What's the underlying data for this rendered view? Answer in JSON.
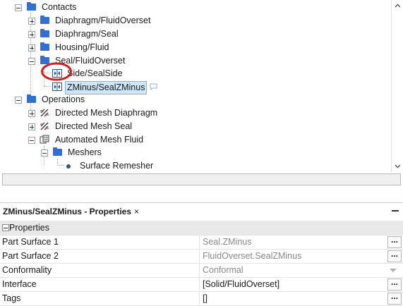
{
  "tree": {
    "contacts": "Contacts",
    "diaphragm_fluidoverset": "Diaphragm/FluidOverset",
    "diaphragm_seal": "Diaphragm/Seal",
    "housing_fluid": "Housing/Fluid",
    "seal_fluidoverset": "Seal/FluidOverset",
    "side_sealside": "Side/SealSide",
    "zminus_sealzminus": "ZMinus/SealZMinus",
    "operations": "Operations",
    "directed_mesh_diaphragm": "Directed Mesh Diaphragm",
    "directed_mesh_seal": "Directed Mesh Seal",
    "automated_mesh_fluid": "Automated Mesh Fluid",
    "meshers": "Meshers",
    "surface_remesher": "Surface Remesher"
  },
  "properties_panel": {
    "tab_title": "ZMinus/SealZMinus - Properties",
    "close_glyph": "×",
    "group": "Properties",
    "rows": [
      {
        "name": "Part Surface 1",
        "value": "Seal.ZMinus"
      },
      {
        "name": "Part Surface 2",
        "value": "FluidOverset.SealZMinus"
      },
      {
        "name": "Conformality",
        "value": "Conformal"
      },
      {
        "name": "Interface",
        "value": "[Solid/FluidOverset]"
      },
      {
        "name": "Tags",
        "value": "[]"
      }
    ],
    "ellipsis": "..."
  }
}
